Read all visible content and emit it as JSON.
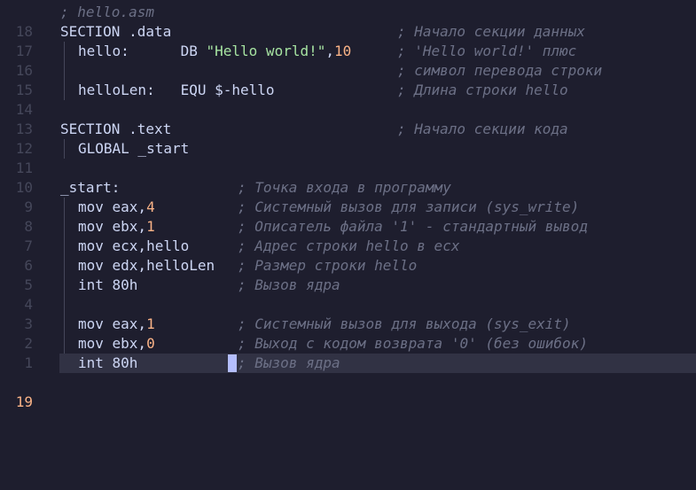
{
  "editor": {
    "current_line": "19",
    "lines": [
      {
        "ln": "18",
        "comment": "; hello.asm"
      },
      {
        "ln": "17",
        "code": "SECTION .data",
        "comment": "; Начало секции данных"
      },
      {
        "ln": "16",
        "code_a": "hello:      DB ",
        "string": "\"Hello world!\"",
        "code_b": ",",
        "number": "10",
        "comment": "; 'Hello world!' плюс"
      },
      {
        "ln": "15",
        "comment": "; символ перевода строки"
      },
      {
        "ln": "14",
        "code": "helloLen:   EQU $-hello",
        "comment": "; Длина строки hello"
      },
      {
        "ln": "13"
      },
      {
        "ln": "12",
        "code": "SECTION .text",
        "comment": "; Начало секции кода"
      },
      {
        "ln": "11",
        "code": "GLOBAL _start"
      },
      {
        "ln": "10"
      },
      {
        "ln": "9",
        "code": "_start:",
        "comment": "; Точка входа в программу"
      },
      {
        "ln": "8",
        "code_a": "mov eax,",
        "number": "4",
        "comment": "; Системный вызов для записи (sys_write)"
      },
      {
        "ln": "7",
        "code_a": "mov ebx,",
        "number": "1",
        "comment": "; Описатель файла '1' - стандартный вывод"
      },
      {
        "ln": "6",
        "code": "mov ecx,hello",
        "comment": "; Адрес строки hello в ecx"
      },
      {
        "ln": "5",
        "code": "mov edx,helloLen",
        "comment": "; Размер строки hello"
      },
      {
        "ln": "4",
        "code": "int 80h",
        "comment": "; Вызов ядра"
      },
      {
        "ln": "3"
      },
      {
        "ln": "2",
        "code_a": "mov eax,",
        "number": "1",
        "comment": "; Системный вызов для выхода (sys_exit)"
      },
      {
        "ln": "1",
        "code_a": "mov ebx,",
        "number": "0",
        "comment": "; Выход с кодом возврата '0' (без ошибок)"
      },
      {
        "ln": "19",
        "code": "int 80h",
        "comment": "; Вызов ядра"
      }
    ]
  },
  "colors": {
    "background": "#1e1e2e",
    "current_line_bg": "#313244",
    "current_line_number": "#fab387",
    "line_number": "#45475a",
    "comment": "#6c7086",
    "string": "#a6e3a1",
    "number": "#fab387",
    "text": "#cdd6f4",
    "cursor": "#b4befe"
  }
}
